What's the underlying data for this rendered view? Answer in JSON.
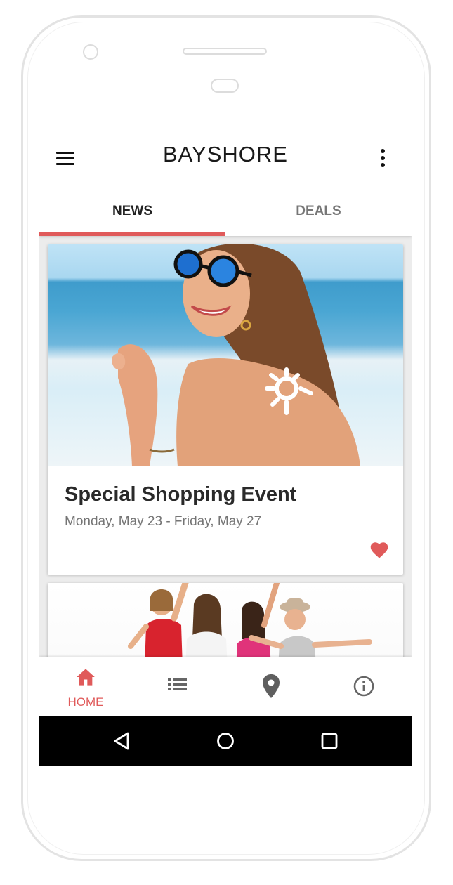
{
  "app": {
    "brand": "BAYSHORE",
    "accent_color": "#e05a5a"
  },
  "header": {
    "menu_icon": "hamburger-menu-icon",
    "overflow_icon": "more-vert-icon"
  },
  "tabs": [
    {
      "label": "NEWS",
      "active": true
    },
    {
      "label": "DEALS",
      "active": false
    }
  ],
  "feed": {
    "cards": [
      {
        "title": "Special Shopping Event",
        "date": "Monday, May 23 - Friday, May 27",
        "favorited": true,
        "image": "woman-with-sunglasses-beach-photo"
      },
      {
        "image": "group-of-friends-dancing-photo"
      }
    ]
  },
  "bottom_nav": {
    "items": [
      {
        "icon": "home-icon",
        "label": "HOME",
        "active": true
      },
      {
        "icon": "list-icon",
        "label": "",
        "active": false
      },
      {
        "icon": "location-pin-icon",
        "label": "",
        "active": false
      },
      {
        "icon": "info-icon",
        "label": "",
        "active": false
      }
    ]
  },
  "system_nav": {
    "buttons": [
      "back-icon",
      "home-circle-icon",
      "recents-icon"
    ]
  }
}
